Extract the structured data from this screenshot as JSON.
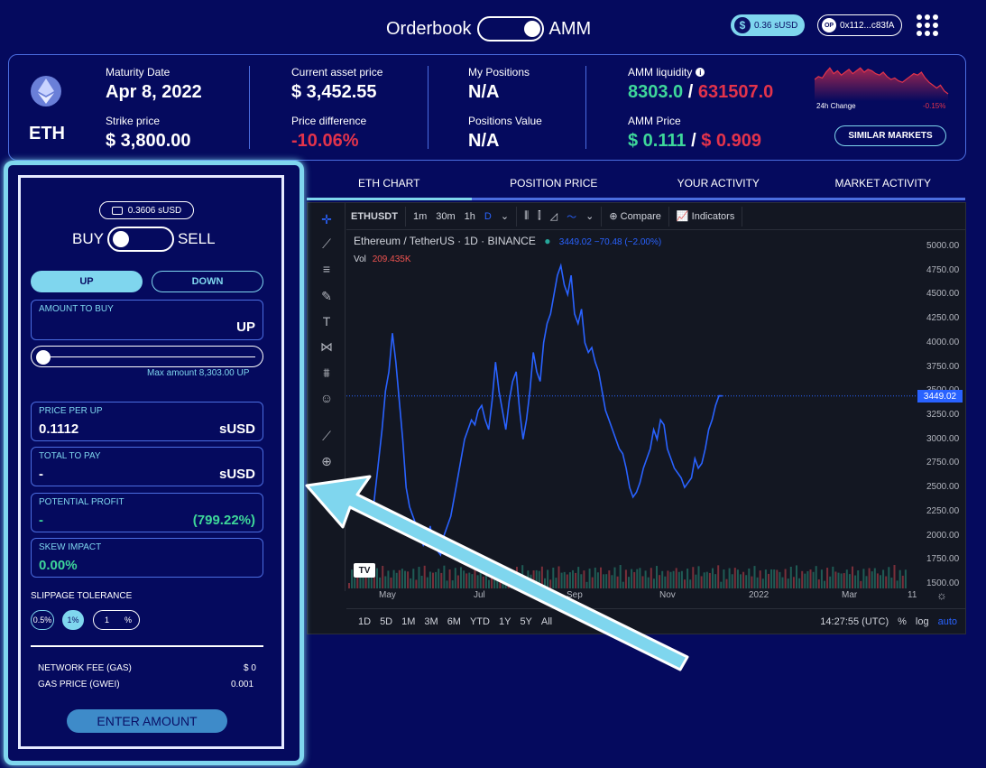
{
  "header": {
    "mode_left": "Orderbook",
    "mode_right": "AMM",
    "balance": "0.36 sUSD",
    "balance_icon": "dollar-coin-icon",
    "address": "0x112...c83fA",
    "address_badge": "OP"
  },
  "market": {
    "asset": "ETH",
    "maturity_label": "Maturity Date",
    "maturity_value": "Apr 8, 2022",
    "strike_label": "Strike price",
    "strike_value": "$ 3,800.00",
    "current_price_label": "Current asset price",
    "current_price_value": "$ 3,452.55",
    "price_diff_label": "Price difference",
    "price_diff_value": "-10.06%",
    "positions_label": "My Positions",
    "positions_value": "N/A",
    "positions_value_label": "Positions Value",
    "positions_value_value": "N/A",
    "amm_liquidity_label": "AMM liquidity",
    "amm_liquidity_up": "8303.0",
    "amm_liquidity_down": "631507.0",
    "amm_price_label": "AMM Price",
    "amm_price_up": "$ 0.111",
    "amm_price_down": "$ 0.909",
    "separator": "/",
    "change_label": "24h Change",
    "change_value": "-0.15%",
    "similar_button": "SIMILAR MARKETS"
  },
  "tabs": [
    "ETH CHART",
    "POSITION PRICE",
    "YOUR ACTIVITY",
    "MARKET ACTIVITY"
  ],
  "trade": {
    "balance": "0.3606 sUSD",
    "buy_label": "BUY",
    "sell_label": "SELL",
    "up_button": "UP",
    "down_button": "DOWN",
    "amount_label": "AMOUNT TO BUY",
    "amount_unit": "UP",
    "max_amount": "Max amount 8,303.00 UP",
    "price_label": "PRICE PER UP",
    "price_value": "0.1112",
    "price_unit": "sUSD",
    "total_label": "TOTAL TO PAY",
    "total_value": "-",
    "total_unit": "sUSD",
    "profit_label": "POTENTIAL PROFIT",
    "profit_value": "-",
    "profit_pct": "(799.22%)",
    "skew_label": "SKEW IMPACT",
    "skew_value": "0.00%",
    "slippage_label": "SLIPPAGE TOLERANCE",
    "slippage_options": [
      "0.5%",
      "1%"
    ],
    "slippage_custom": "1",
    "slippage_custom_unit": "%",
    "fee_label": "NETWORK FEE (GAS)",
    "fee_value": "$ 0",
    "gas_label": "GAS PRICE (GWEI)",
    "gas_value": "0.001",
    "enter_button": "ENTER AMOUNT"
  },
  "tradingview": {
    "symbol": "ETHUSDT",
    "intervals": [
      "1m",
      "30m",
      "1h",
      "D"
    ],
    "compare": "Compare",
    "indicators": "Indicators",
    "legend_title": "Ethereum / TetherUS · 1D · BINANCE",
    "legend_values": "3449.02  −70.48 (−2.00%)",
    "vol_label": "Vol",
    "vol_value": "209.435K",
    "last_price": "3449.02",
    "ranges": [
      "1D",
      "5D",
      "1M",
      "3M",
      "6M",
      "YTD",
      "1Y",
      "5Y",
      "All"
    ],
    "time": "14:27:55 (UTC)",
    "pct": "%",
    "log": "log",
    "auto": "auto",
    "logo": "TV"
  },
  "chart_data": {
    "type": "line",
    "y_ticks": [
      "5000.00",
      "4750.00",
      "4500.00",
      "4250.00",
      "4000.00",
      "3750.00",
      "3500.00",
      "3250.00",
      "3000.00",
      "2750.00",
      "2500.00",
      "2250.00",
      "2000.00",
      "1750.00",
      "1500.00"
    ],
    "x_ticks": [
      "May",
      "Jul",
      "Sep",
      "Nov",
      "2022",
      "Mar",
      "11"
    ],
    "ylim": [
      1500,
      5000
    ],
    "x": [
      0,
      5,
      10,
      14,
      18,
      22,
      26,
      30,
      34,
      38,
      42,
      46,
      50,
      54,
      58,
      62,
      66,
      70,
      74,
      78,
      82,
      86,
      90,
      94,
      98,
      102,
      106,
      110,
      114,
      118,
      122,
      126,
      130,
      134,
      138,
      142,
      146,
      150,
      154,
      158,
      162,
      166,
      170,
      174,
      178,
      182,
      186,
      190,
      194,
      198,
      202,
      206,
      210,
      214,
      218,
      222,
      226,
      230,
      234,
      238,
      242,
      246,
      250,
      254,
      258,
      262,
      266,
      270,
      274,
      278,
      282,
      286,
      290,
      294,
      298,
      302,
      306,
      310,
      314,
      318,
      322,
      326,
      330,
      334,
      338,
      342,
      346,
      350,
      354,
      358,
      362,
      366,
      370,
      374,
      378,
      382,
      386,
      390,
      394,
      398,
      402,
      406,
      410,
      414,
      418,
      422,
      426,
      430,
      434,
      438,
      442,
      446,
      450,
      454,
      458,
      462,
      466,
      470,
      474,
      478,
      482,
      486,
      490,
      494,
      498,
      502,
      506,
      510,
      514,
      518,
      522,
      526,
      530,
      534,
      538,
      542,
      546,
      550,
      554,
      558,
      562,
      566,
      570,
      574,
      578,
      582,
      586,
      590,
      594,
      598,
      602,
      606,
      610,
      614
    ],
    "values": [
      2300,
      2700,
      3100,
      3500,
      3700,
      4100,
      3800,
      3400,
      3000,
      2500,
      2300,
      2200,
      2100,
      2000,
      1900,
      1950,
      2100,
      1900,
      1850,
      1800,
      2000,
      2100,
      2200,
      2400,
      2600,
      2800,
      3000,
      3100,
      3200,
      3150,
      3300,
      3350,
      3200,
      3100,
      3400,
      3800,
      3500,
      3300,
      3100,
      3400,
      3600,
      3700,
      3300,
      3000,
      3200,
      3500,
      3900,
      3700,
      3600,
      4000,
      4200,
      4300,
      4500,
      4700,
      4800,
      4600,
      4500,
      4700,
      4300,
      4200,
      4350,
      4000,
      3900,
      3950,
      3800,
      3700,
      3500,
      3300,
      3200,
      3100,
      3000,
      2900,
      2850,
      2700,
      2500,
      2400,
      2450,
      2550,
      2700,
      2800,
      2900,
      3100,
      3000,
      3200,
      3150,
      2900,
      2800,
      2700,
      2650,
      2600,
      2500,
      2550,
      2600,
      2800,
      2700,
      2750,
      2900,
      3100,
      3200,
      3350,
      3450,
      3449
    ]
  },
  "mini_chart": {
    "values": [
      30,
      32,
      31,
      35,
      38,
      34,
      36,
      33,
      35,
      37,
      34,
      36,
      38,
      35,
      37,
      36,
      34,
      33,
      35,
      32,
      30,
      31,
      29,
      28,
      30,
      32,
      34,
      33,
      35,
      31,
      28,
      26,
      24,
      26,
      22,
      20
    ]
  }
}
